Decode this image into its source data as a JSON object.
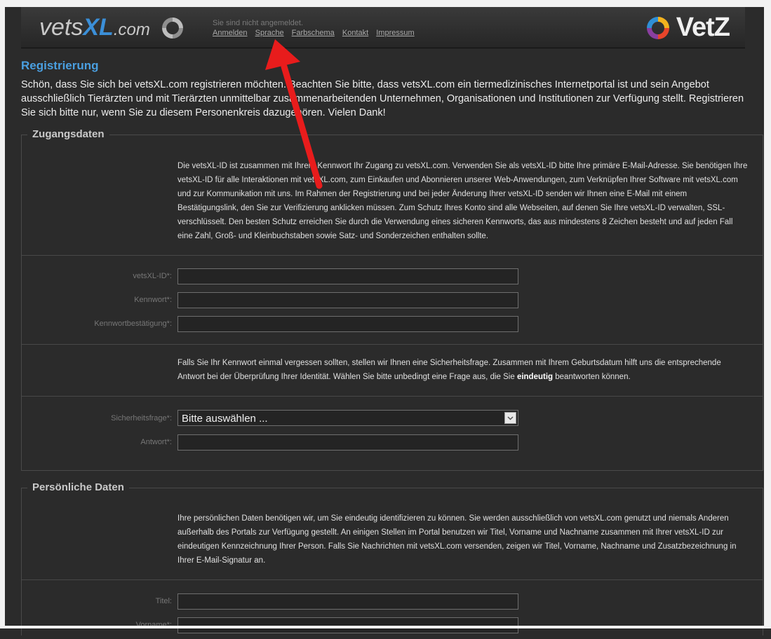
{
  "header": {
    "logo_left_main": "vets",
    "logo_left_accent": "XL",
    "logo_left_suffix": ".com",
    "login_status": "Sie sind nicht angemeldet.",
    "nav": [
      "Anmelden",
      "Sprache",
      "Farbschema",
      "Kontakt",
      "Impressum"
    ],
    "logo_right": "VetZ"
  },
  "page": {
    "title": "Registrierung",
    "intro": "Schön, dass Sie sich bei vetsXL.com registrieren möchten. Beachten Sie bitte, dass vetsXL.com ein tiermedizinisches Internetportal ist und sein Angebot ausschließlich Tierärzten und mit Tierärzten unmittelbar zusammenarbeitenden Unternehmen, Organisationen und Institutionen zur Verfügung stellt. Registrieren Sie sich bitte nur, wenn Sie zu diesem Personenkreis dazugehören. Vielen Dank!"
  },
  "access": {
    "legend": "Zugangsdaten",
    "desc1": "Die vetsXL-ID ist zusammen mit Ihrem Kennwort Ihr Zugang zu vetsXL.com. Verwenden Sie als vetsXL-ID bitte Ihre primäre E-Mail-Adresse. Sie benötigen Ihre vetsXL-ID für alle Interaktionen mit vetsXL.com, zum Einkaufen und Abonnieren unserer Web-Anwendungen, zum Verknüpfen Ihrer Software mit vetsXL.com und zur Kommunikation mit uns. Im Rahmen der Registrierung und bei jeder Änderung Ihrer vetsXL-ID senden wir Ihnen eine E-Mail mit einem Bestätigungslink, den Sie zur Verifizierung anklicken müssen. Zum Schutz Ihres Konto sind alle Webseiten, auf denen Sie Ihre vetsXL-ID verwalten, SSL-verschlüsselt. Den besten Schutz erreichen Sie durch die Verwendung eines sicheren Kennworts, das aus mindestens 8 Zeichen besteht und auf jeden Fall eine Zahl, Groß- und Kleinbuchstaben sowie Satz- und Sonderzeichen enthalten sollte.",
    "label_id": "vetsXL-ID*:",
    "label_pw": "Kennwort*:",
    "label_pw2": "Kennwortbestätigung*:",
    "desc2_a": "Falls Sie Ihr Kennwort einmal vergessen sollten, stellen wir Ihnen eine Sicherheitsfrage. Zusammen mit Ihrem Geburtsdatum hilft uns die entsprechende Antwort bei der Überprüfung Ihrer Identität. Wählen Sie bitte unbedingt eine Frage aus, die Sie ",
    "desc2_bold": "eindeutig",
    "desc2_b": " beantworten können.",
    "label_question": "Sicherheitsfrage*:",
    "question_value": "Bitte auswählen ...",
    "label_answer": "Antwort*:"
  },
  "personal": {
    "legend": "Persönliche Daten",
    "desc": "Ihre persönlichen Daten benötigen wir, um Sie eindeutig identifizieren zu können. Sie werden ausschließlich von vetsXL.com genutzt und niemals Anderen außerhalb des Portals zur Verfügung gestellt. An einigen Stellen im Portal benutzen wir Titel, Vorname und Nachname zusammen mit Ihrer vetsXL-ID zur eindeutigen Kennzeichnung Ihrer Person. Falls Sie Nachrichten mit vetsXL.com versenden, zeigen wir Titel, Vorname, Nachname und Zusatzbezeichnung in Ihrer E-Mail-Signatur an.",
    "label_title": "Titel:",
    "label_first": "Vorname*:"
  },
  "colors": {
    "accent": "#4a9fe0",
    "annotation_arrow": "#e81c1c"
  }
}
